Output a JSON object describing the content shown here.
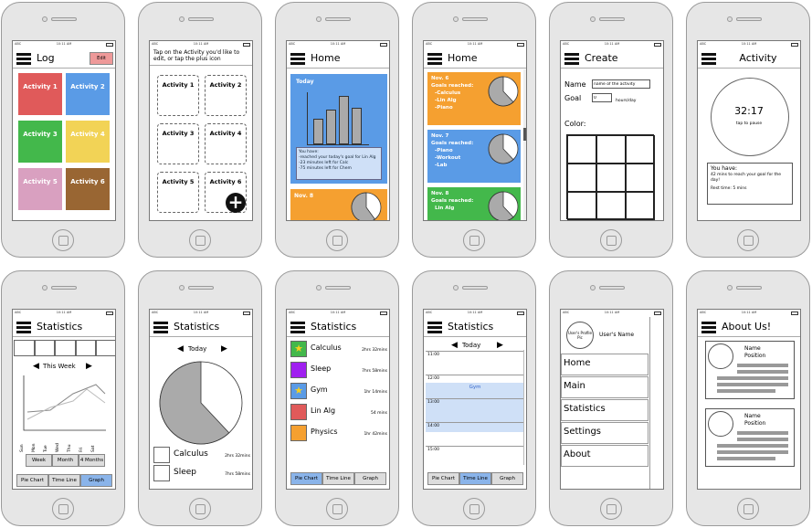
{
  "status": {
    "carrier": "ABC",
    "time": "10:11 AM"
  },
  "colors": {
    "red": "#e05a5a",
    "blue": "#5a9be6",
    "green": "#43b84b",
    "yellow": "#f2d356",
    "pink": "#d9a0c0",
    "brown": "#996633",
    "orange": "#f5a030",
    "purple": "#a020f0",
    "gray_pie": "#aaaaaa",
    "selected": "#8ab4ea"
  },
  "s1": {
    "title": "Log",
    "edit": "Edit",
    "tiles": [
      "Activity 1",
      "Activity 2",
      "Activity 3",
      "Activity 4",
      "Activity 5",
      "Activity 6"
    ]
  },
  "s2": {
    "instructions": "Tap on the Activity you'd like to edit, or tap the plus icon",
    "tiles": [
      "Activity 1",
      "Activity 2",
      "Activity 3",
      "Activity 4",
      "Activity 5",
      "Activity 6"
    ]
  },
  "s3": {
    "title": "Home",
    "card_title": "Today",
    "summary": [
      "You have:",
      "-reached your today's goal for Lin Alg",
      "-23 minutes left for Calc",
      "-75 minutes left for Chem"
    ],
    "next_card": "Nov. 8"
  },
  "s4": {
    "title": "Home",
    "cards": [
      {
        "date": "Nov. 6",
        "lines": [
          "Goals reached:",
          "-Calculus",
          "-Lin Alg",
          "-Piano"
        ]
      },
      {
        "date": "Nov. 7",
        "lines": [
          "Goals reached:",
          "-Piano",
          "-Workout",
          "-Lab"
        ]
      },
      {
        "date": "Nov. 8",
        "lines": [
          "Goals reached:",
          "Lin Alg"
        ]
      }
    ]
  },
  "s5": {
    "title": "Create",
    "name_label": "Name",
    "name_value": "name of the activity",
    "goal_label": "Goal",
    "goal_value": "0",
    "goal_unit": "hours/day",
    "color_label": "Color:"
  },
  "s6": {
    "title": "Activity",
    "time": "32:17",
    "tap": "tap to pause",
    "info": [
      "You have:",
      "42 mins to reach your goal for the day!",
      "Rest time: 5 mins"
    ]
  },
  "s7": {
    "title": "Statistics",
    "week": "This Week",
    "days": [
      "Sun",
      "Mon",
      "Tue",
      "Wed",
      "Thu",
      "Fri",
      "Sat"
    ],
    "range_buttons": [
      "Week",
      "Month",
      "4 Months"
    ],
    "view_buttons": [
      "Pie Chart",
      "Time Line",
      "Graph"
    ]
  },
  "s8": {
    "title": "Statistics",
    "day": "Today",
    "rows": [
      {
        "name": "Calculus",
        "time": "2hrs 32mins"
      },
      {
        "name": "Sleep",
        "time": "7hrs 58mins"
      }
    ]
  },
  "s9": {
    "title": "Statistics",
    "rows": [
      {
        "name": "Calculus",
        "time": "2hrs 32mins"
      },
      {
        "name": "Sleep",
        "time": "7hrs 58mins"
      },
      {
        "name": "Gym",
        "time": "1hr 14mins"
      },
      {
        "name": "Lin Alg",
        "time": "54 mins"
      },
      {
        "name": "Physics",
        "time": "1hr 42mins"
      }
    ],
    "view_buttons": [
      "Pie Chart",
      "Time Line",
      "Graph"
    ]
  },
  "s10": {
    "title": "Statistics",
    "day": "Today",
    "hours": [
      "11:00",
      "12:00",
      "13:00",
      "14:00",
      "15:00"
    ],
    "event": "Gym",
    "view_buttons": [
      "Pie Chart",
      "Time Line",
      "Graph"
    ]
  },
  "s11": {
    "profile_pic": "User's Profile Pic",
    "user_name": "User's Name",
    "items": [
      "Home",
      "Main",
      "Statistics",
      "Settings",
      "About"
    ]
  },
  "s12": {
    "title": "About Us!",
    "people": [
      {
        "name": "Name",
        "position": "Position"
      },
      {
        "name": "Name",
        "position": "Position"
      }
    ]
  }
}
